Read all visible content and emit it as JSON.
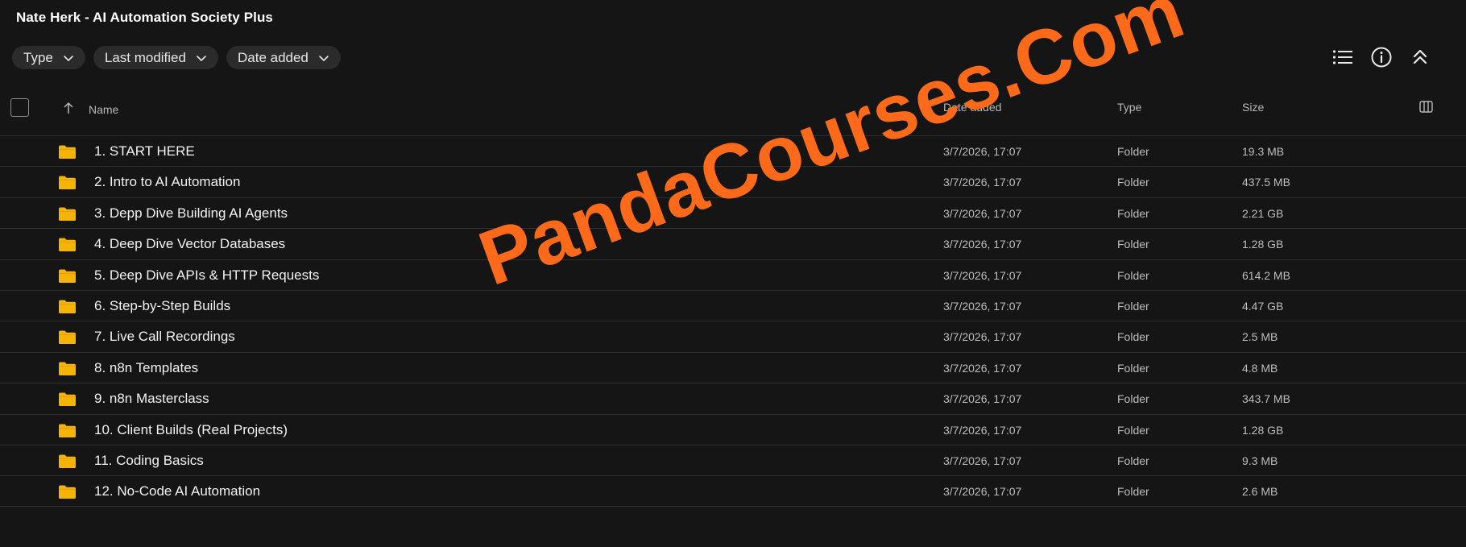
{
  "title": "Nate Herk - AI Automation Society Plus",
  "filters": [
    {
      "label": "Type"
    },
    {
      "label": "Last modified"
    },
    {
      "label": "Date added"
    }
  ],
  "toolbar_icons": [
    "list-view-icon",
    "info-icon",
    "collapse-icon"
  ],
  "columns": {
    "name": "Name",
    "date_added": "Date added",
    "type": "Type",
    "size": "Size"
  },
  "rows": [
    {
      "name": "1. START HERE",
      "date": "3/7/2026, 17:07",
      "type": "Folder",
      "size": "19.3 MB"
    },
    {
      "name": "2. Intro to AI Automation",
      "date": "3/7/2026, 17:07",
      "type": "Folder",
      "size": "437.5 MB"
    },
    {
      "name": "3. Depp Dive Building AI Agents",
      "date": "3/7/2026, 17:07",
      "type": "Folder",
      "size": "2.21 GB"
    },
    {
      "name": "4. Deep Dive Vector Databases",
      "date": "3/7/2026, 17:07",
      "type": "Folder",
      "size": "1.28 GB"
    },
    {
      "name": "5. Deep Dive APIs & HTTP Requests",
      "date": "3/7/2026, 17:07",
      "type": "Folder",
      "size": "614.2 MB"
    },
    {
      "name": "6. Step-by-Step Builds",
      "date": "3/7/2026, 17:07",
      "type": "Folder",
      "size": "4.47 GB"
    },
    {
      "name": "7. Live Call Recordings",
      "date": "3/7/2026, 17:07",
      "type": "Folder",
      "size": "2.5 MB"
    },
    {
      "name": "8. n8n Templates",
      "date": "3/7/2026, 17:07",
      "type": "Folder",
      "size": "4.8 MB"
    },
    {
      "name": "9. n8n Masterclass",
      "date": "3/7/2026, 17:07",
      "type": "Folder",
      "size": "343.7 MB"
    },
    {
      "name": "10. Client Builds (Real Projects)",
      "date": "3/7/2026, 17:07",
      "type": "Folder",
      "size": "1.28 GB"
    },
    {
      "name": "11. Coding Basics",
      "date": "3/7/2026, 17:07",
      "type": "Folder",
      "size": "9.3 MB"
    },
    {
      "name": "12. No-Code AI Automation",
      "date": "3/7/2026, 17:07",
      "type": "Folder",
      "size": "2.6 MB"
    }
  ],
  "watermark": "PandaCourses.Com",
  "colors": {
    "background": "#151515",
    "folder": "#f5b400",
    "watermark": "#ff6a1a",
    "chip": "#2b2b2b"
  }
}
